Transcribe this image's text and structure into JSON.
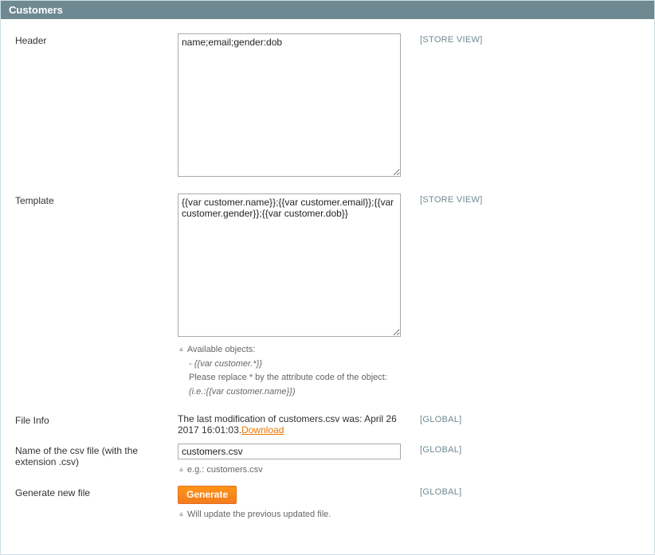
{
  "panel_title": "Customers",
  "scopes": {
    "store_view": "[STORE VIEW]",
    "global": "[GLOBAL]"
  },
  "fields": {
    "header": {
      "label": "Header",
      "value": "name;email;gender:dob"
    },
    "template": {
      "label": "Template",
      "value": "{{var customer.name}};{{var customer.email}};{{var customer.gender}};{{var customer.dob}}",
      "note_title": "Available objects:",
      "note_var": "- {{var customer.*}}",
      "note_instruction": "Please replace * by the attribute code of the object:",
      "note_example": "(i.e.:{{var customer.name}})"
    },
    "file_info": {
      "label": "File Info",
      "text": "The last modification of customers.csv was: April 26 2017 16:01:03.",
      "download_label": "Download"
    },
    "filename": {
      "label": "Name of the csv file (with the extension .csv)",
      "value": "customers.csv",
      "note": "e.g.: customers.csv"
    },
    "generate": {
      "label": "Generate new file",
      "button": "Generate",
      "note": "Will update the previous updated file."
    }
  }
}
